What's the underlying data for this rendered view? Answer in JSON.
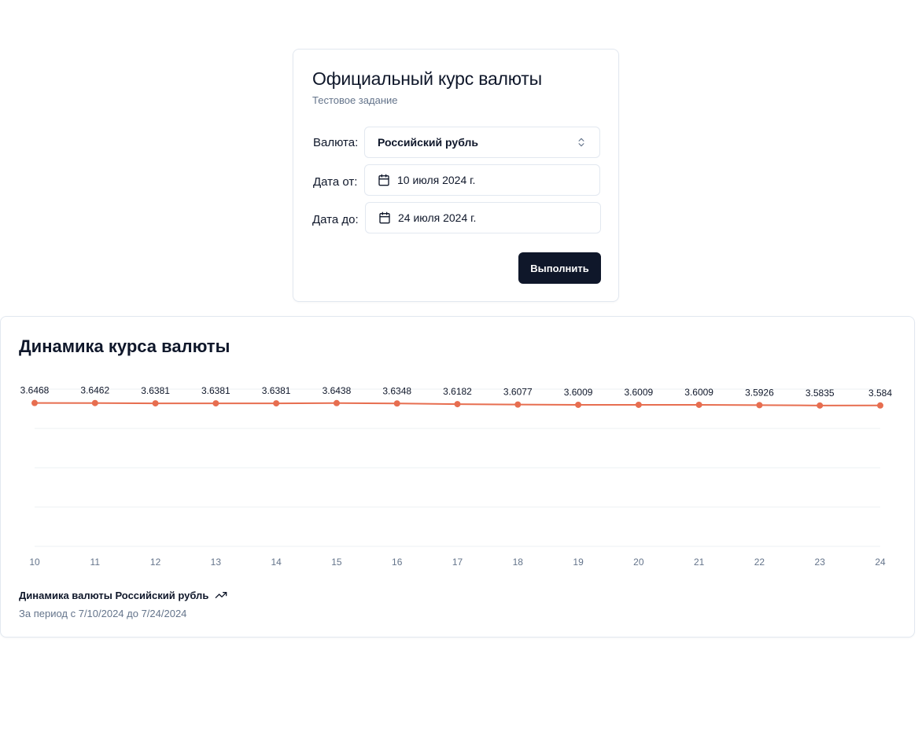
{
  "form": {
    "title": "Официальный курс валюты",
    "subtitle": "Тестовое задание",
    "currency_label": "Валюта:",
    "currency_value": "Российский рубль",
    "date_from_label": "Дата от:",
    "date_from_value": "10 июля 2024 г.",
    "date_to_label": "Дата до:",
    "date_to_value": "24 июля 2024 г.",
    "submit_label": "Выполнить"
  },
  "chart_card": {
    "title": "Динамика курса валюты",
    "footer_main": "Динамика валюты Российский рубль",
    "footer_sub": "За период с 7/10/2024 до 7/24/2024"
  },
  "colors": {
    "line": "#e76e50",
    "button_bg": "#0f172a",
    "muted_text": "#64748b",
    "grid": "#eef0f3"
  },
  "chart_data": {
    "type": "line",
    "x": [
      "10",
      "11",
      "12",
      "13",
      "14",
      "15",
      "16",
      "17",
      "18",
      "19",
      "20",
      "21",
      "22",
      "23",
      "24"
    ],
    "series": [
      {
        "values": [
          3.6468,
          3.6462,
          3.6381,
          3.6381,
          3.6381,
          3.6438,
          3.6348,
          3.6182,
          3.6077,
          3.6009,
          3.6009,
          3.6009,
          3.5926,
          3.5835,
          3.584
        ]
      }
    ],
    "value_labels": [
      "3.6468",
      "3.6462",
      "3.6381",
      "3.6381",
      "3.6381",
      "3.6438",
      "3.6348",
      "3.6182",
      "3.6077",
      "3.6009",
      "3.6009",
      "3.6009",
      "3.5926",
      "3.5835",
      "3.584"
    ],
    "ylim": [
      0,
      4
    ],
    "grid": true,
    "legend": "none"
  }
}
